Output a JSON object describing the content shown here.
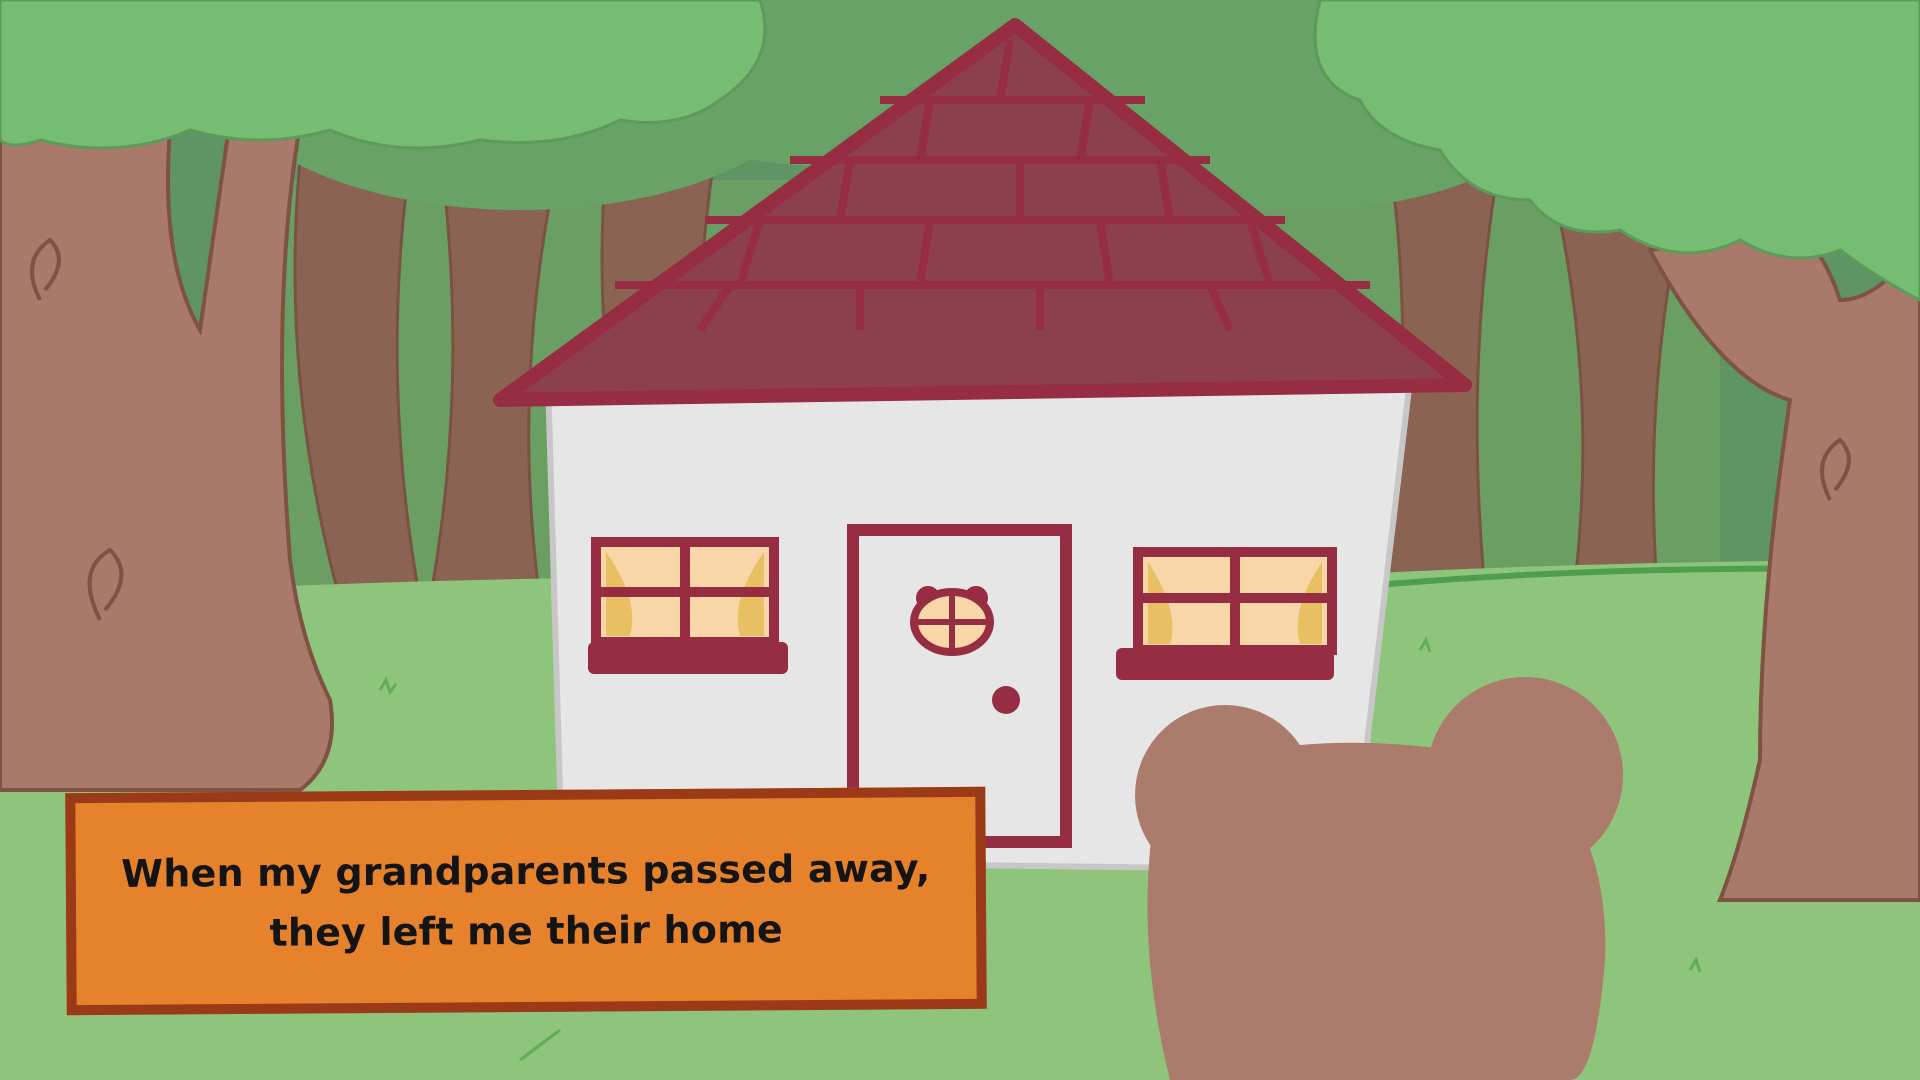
{
  "dialog": {
    "text": "When my grandparents passed away, they left me their home"
  },
  "colors": {
    "grass": "#8fc47c",
    "forest_back": "#5f9465",
    "canopy_back": "#68a266",
    "canopy_front": "#74bd72",
    "tree_trunk": "#a9796a",
    "tree_trunk_dark": "#8a6352",
    "house_wall": "#e6e6e6",
    "house_trim": "#962d42",
    "roof": "#8c3f4f",
    "window_glass": "#f8d6a8",
    "curtain": "#e8c063",
    "bear": "#ab7b6c",
    "dialog_fill": "#e6822c",
    "dialog_border": "#9a3a17"
  }
}
